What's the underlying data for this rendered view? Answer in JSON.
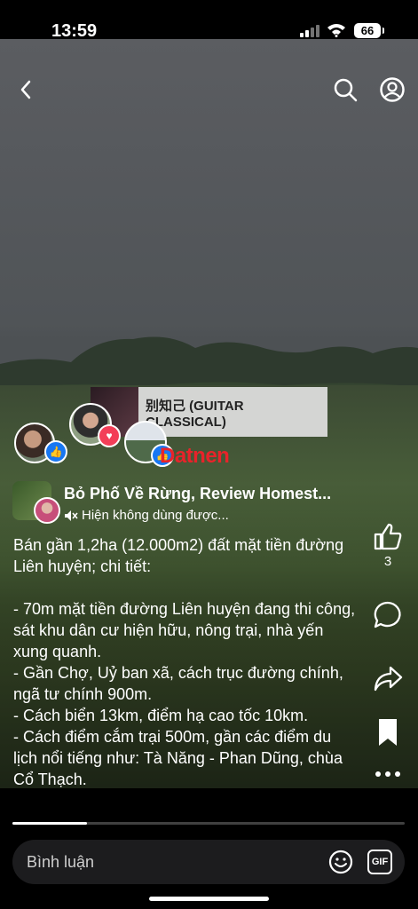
{
  "status_bar": {
    "time": "13:59",
    "battery": "66"
  },
  "music": {
    "title": "别知己 (GUITAR CLASSICAL)"
  },
  "watermark": "Datnen",
  "page": {
    "name": "Bỏ Phố Về Rừng, Review Homest...",
    "audio": "Hiện không dùng được..."
  },
  "caption": {
    "text": "Bán gần 1,2ha (12.000m2) đất mặt tiền đường Liên huyện; chi tiết:\n\n- 70m mặt tiền đường Liên huyện đang thi công, sát khu dân cư hiện hữu, nông trại, nhà yến xung quanh.\n- Gần Chợ, Uỷ ban xã, cách trục đường chính, ngã tư chính 900m.\n- Cách biển 13km, điểm hạ cao tốc 10km.\n- Cách điểm cắm trại 500m, gần các điểm du lịch nổi tiếng như: Tà Năng - Phan Dũng, chùa Cổ Thạch."
  },
  "actions": {
    "like_count": "3"
  },
  "progress": {
    "fraction": 0.19
  },
  "comment_bar": {
    "placeholder": "Bình luận",
    "gif_label": "GIF"
  },
  "icons": [
    "back-icon",
    "search-icon",
    "profile-icon",
    "like-icon",
    "comment-icon",
    "share-icon",
    "bookmark-icon",
    "more-icon",
    "emoji-icon",
    "gif-icon",
    "speaker-muted-icon"
  ],
  "colors": {
    "reaction_like": "#1877f2",
    "reaction_love": "#f33e58",
    "watermark": "#e8232a"
  }
}
